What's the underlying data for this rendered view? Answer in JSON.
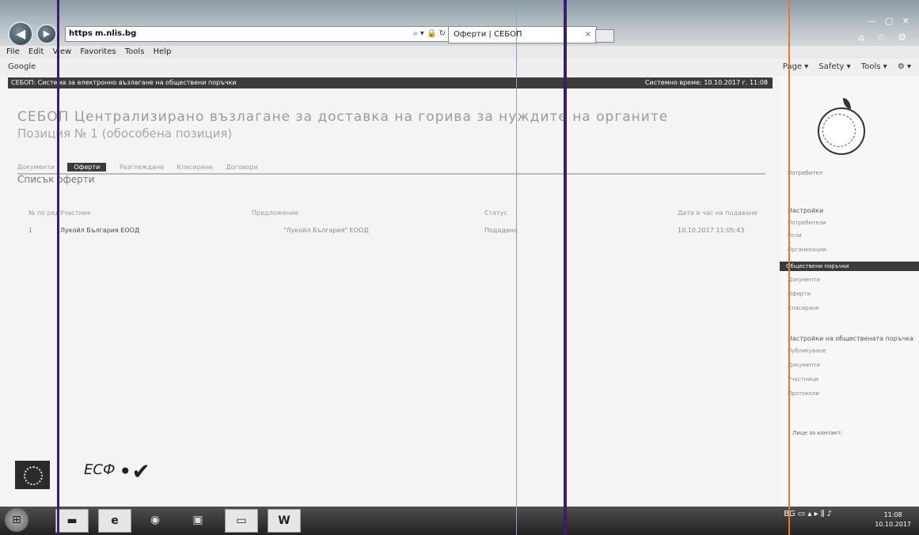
{
  "browser": {
    "url_host": "https",
    "url_domain": "m.nlis.bg",
    "tab_title": "Оферти | СЕБОП",
    "menu": [
      "File",
      "Edit",
      "View",
      "Favorites",
      "Tools",
      "Help"
    ],
    "favorites_label": "Google",
    "toolbar": [
      "Page ▾",
      "Safety ▾",
      "Tools ▾",
      "⚙ ▾"
    ],
    "infobar_left": "СЕБОП: Система за електронно възлагане на обществени поръчки",
    "infobar_right": "Системно време: 10.10.2017 г. 11:08"
  },
  "page": {
    "title": "СЕБОП Централизирано възлагане за доставка на горива за нуждите на органите",
    "subtitle": "Позиция № 1 (обособена позиция)",
    "steps": [
      "Документи",
      "Оферти",
      "Разглеждане",
      "Класиране",
      "Договори"
    ],
    "active_step": "Оферти",
    "section": "Списък оферти",
    "headers": [
      "№ по ред",
      "Участник",
      "Предложение",
      "Статус",
      "Дата и час на подаване"
    ],
    "rows": [
      {
        "num": "1",
        "name": "Лукойл България ЕООД",
        "offer": "\"Лукойл България\" ЕООД",
        "status": "Подадена",
        "date": "10.10.2017 11:05:43"
      },
      {
        "num": "",
        "name": "",
        "offer": "",
        "status": "",
        "date": ""
      },
      {
        "num": "",
        "name": "",
        "offer": "",
        "status": "",
        "date": ""
      }
    ]
  },
  "sidebar": {
    "user": "Потребител",
    "h1": "Настройки",
    "items1": [
      "Потребители",
      "Роли",
      "Организации"
    ],
    "active": "Обществени поръчки",
    "items2": [
      "Документи",
      "Оферти",
      "Класиране"
    ],
    "h2": "Настройки на обществената поръчка",
    "items3": [
      "Публикуване",
      "Документи",
      "Участници",
      "Протоколи"
    ],
    "contact_title": "Лице за контакт:"
  },
  "footer": {
    "esf_label": "ЕСФ"
  },
  "taskbar": {
    "word_label": "W",
    "lang": "BG",
    "time": "11:08",
    "date": "10.10.2017"
  },
  "colors": {
    "chrome_top": "#8a9aa6",
    "accent_dark": "#3a3a3a",
    "scan_line_1": "#3b1e6a",
    "scan_line_2": "#7fa6cf",
    "scan_line_3": "#e8792a"
  }
}
